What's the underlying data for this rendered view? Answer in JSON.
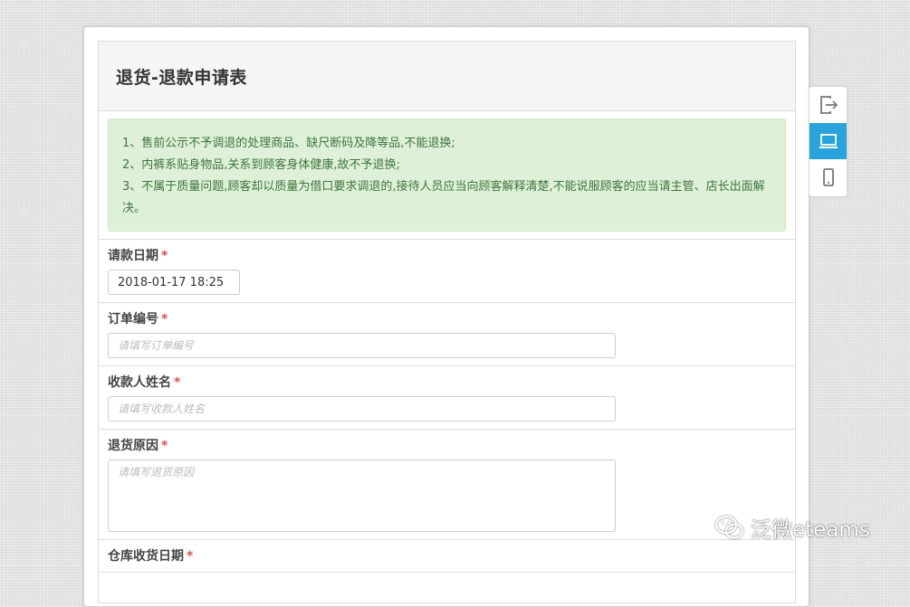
{
  "form": {
    "title": "退货-退款申请表",
    "notice": [
      "1、售前公示不予调退的处理商品、缺尺断码及降等品,不能退换;",
      "2、内裤系贴身物品,关系到顾客身体健康,故不予退换;",
      "3、不属于质量问题,顾客却以质量为借口要求调退的,接待人员应当向顾客解释清楚,不能说服顾客的应当请主管、店长出面解决。"
    ],
    "fields": [
      {
        "label": "请款日期",
        "required_mark": "*",
        "value": "2018-01-17 18:25",
        "placeholder": ""
      },
      {
        "label": "订单编号",
        "required_mark": "*",
        "value": "",
        "placeholder": "请填写订单编号"
      },
      {
        "label": "收款人姓名",
        "required_mark": "*",
        "value": "",
        "placeholder": "请填写收款人姓名"
      },
      {
        "label": "退货原因",
        "required_mark": "*",
        "value": "",
        "placeholder": "请填写退货原因"
      },
      {
        "label": "仓库收货日期",
        "required_mark": "*"
      }
    ]
  },
  "toolbar": {
    "items": [
      {
        "icon": "exit-icon",
        "active": false
      },
      {
        "icon": "desktop-icon",
        "active": true
      },
      {
        "icon": "mobile-icon",
        "active": false
      }
    ],
    "active_color": "#29a3db"
  },
  "watermark": {
    "icon": "wechat-icon",
    "text": "泛微eteams"
  },
  "colors": {
    "notice_bg": "#dff0d8",
    "notice_text": "#3c763d",
    "required": "#d9534f"
  }
}
